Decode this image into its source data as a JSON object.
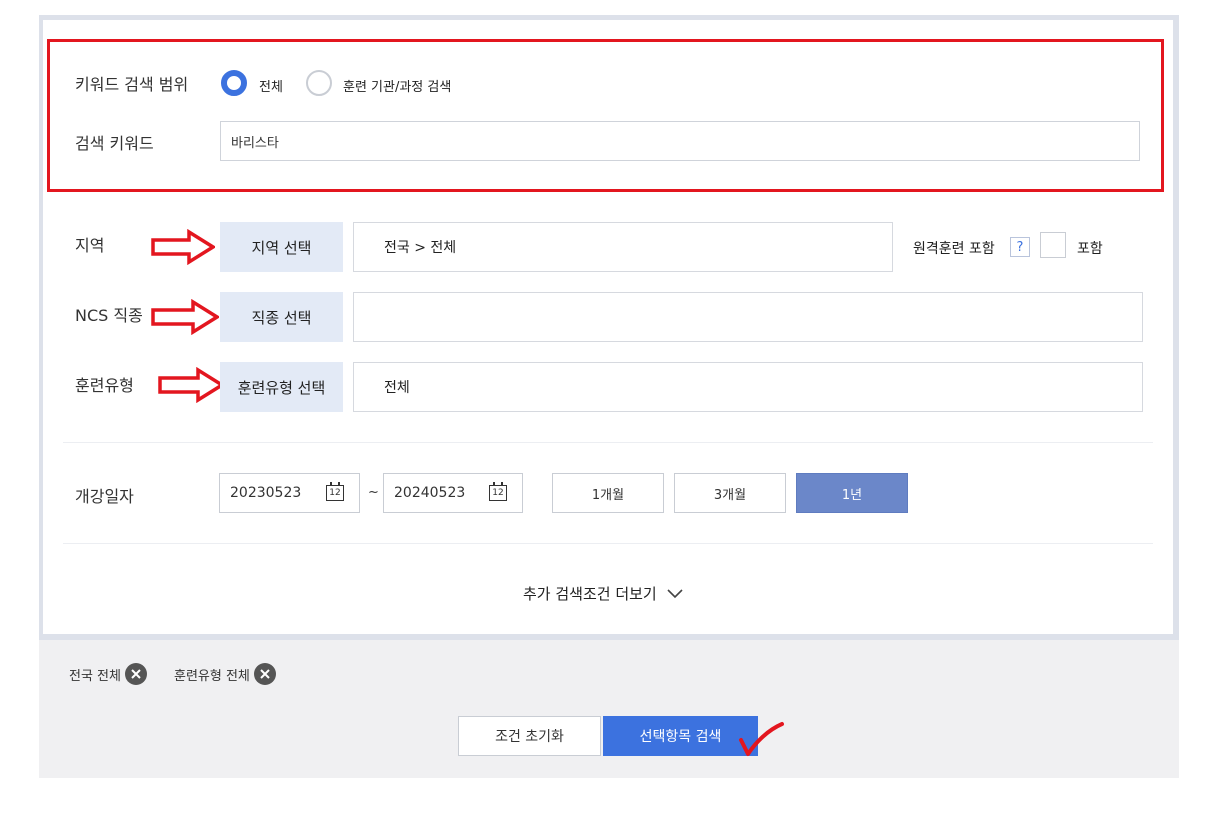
{
  "keyword": {
    "scope_label": "키워드 검색 범위",
    "options": [
      {
        "label": "전체",
        "selected": true
      },
      {
        "label": "훈련 기관/과정 검색",
        "selected": false
      }
    ],
    "input_label": "검색 키워드",
    "input_value": "바리스타"
  },
  "filters": {
    "region": {
      "label": "지역",
      "button_label": "지역 선택",
      "value": "전국 > 전체"
    },
    "remote": {
      "label": "원격훈련 포함",
      "help": "?",
      "checkbox_label": "포함",
      "checked": false
    },
    "ncs": {
      "label": "NCS 직종",
      "button_label": "직종 선택",
      "value": ""
    },
    "training_type": {
      "label": "훈련유형",
      "button_label": "훈련유형 선택",
      "value": "전체"
    }
  },
  "dates": {
    "label": "개강일자",
    "start": "20230523",
    "separator": "~",
    "end": "20240523",
    "calendar_icon_text": "12",
    "periods": [
      {
        "label": "1개월",
        "active": false
      },
      {
        "label": "3개월",
        "active": false
      },
      {
        "label": "1년",
        "active": true
      }
    ]
  },
  "more_label": "추가 검색조건 더보기",
  "tags": [
    {
      "label": "전국 전체"
    },
    {
      "label": "훈련유형 전체"
    }
  ],
  "actions": {
    "reset_label": "조건 초기화",
    "search_label": "선택항목 검색"
  },
  "colors": {
    "annotation": "#e3161f",
    "accent": "#3c72df",
    "active_period": "#6b87c9"
  }
}
